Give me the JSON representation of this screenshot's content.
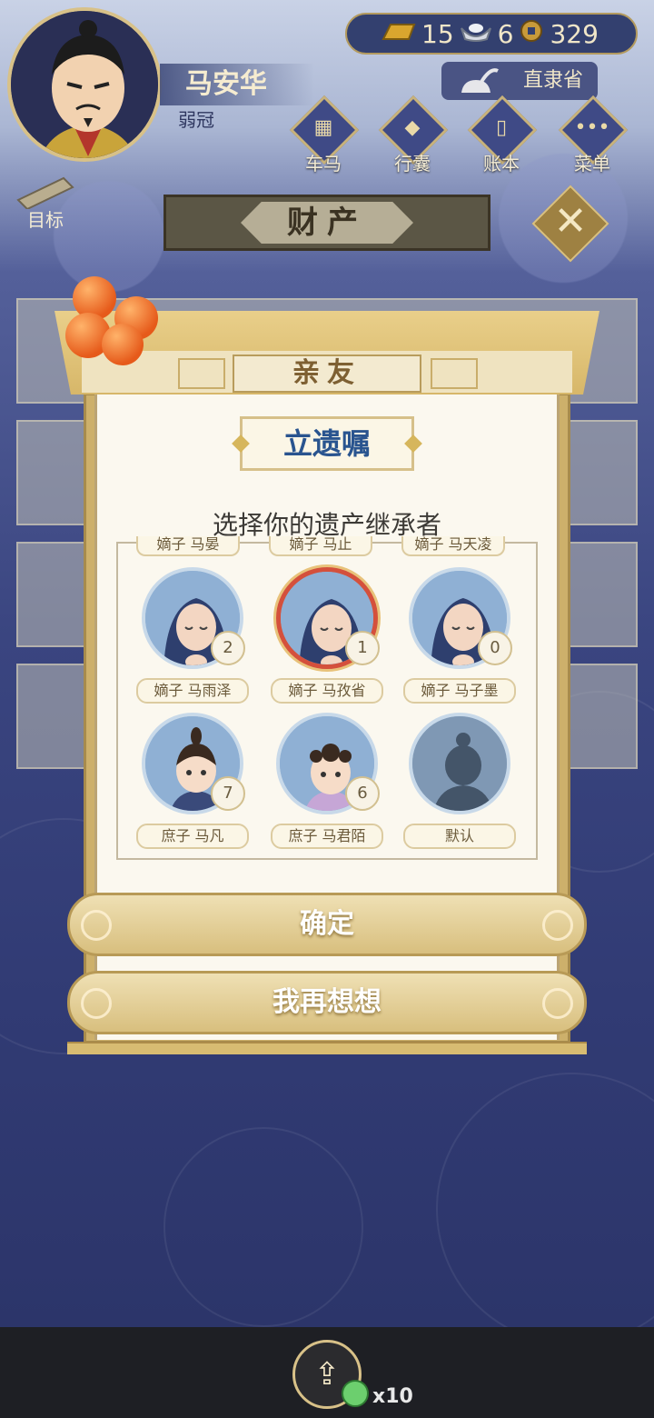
{
  "player": {
    "name": "马安华",
    "title": "弱冠"
  },
  "currency": {
    "gold": "15",
    "silver": "6",
    "coins": "329"
  },
  "region": {
    "label": "直隶省"
  },
  "menu": [
    {
      "label": "车马",
      "icon": "carriage-icon"
    },
    {
      "label": "行囊",
      "icon": "bag-icon"
    },
    {
      "label": "账本",
      "icon": "ledger-icon"
    },
    {
      "label": "菜单",
      "icon": "more-icon"
    }
  ],
  "goal": {
    "label": "目标"
  },
  "section": {
    "title": "财产"
  },
  "dialog": {
    "tab": "亲友",
    "title": "立遗嘱",
    "subtitle": "选择你的遗产继承者",
    "cut_labels": [
      "嫡子 马晏",
      "嫡子 马止",
      "嫡子 马天凌"
    ],
    "heirs": [
      {
        "label": "嫡子 马雨泽",
        "count": "2",
        "selected": false,
        "type": "monk"
      },
      {
        "label": "嫡子 马孜省",
        "count": "1",
        "selected": true,
        "type": "monk"
      },
      {
        "label": "嫡子 马子墨",
        "count": "0",
        "selected": false,
        "type": "monk"
      },
      {
        "label": "庶子 马凡",
        "count": "7",
        "selected": false,
        "type": "boy"
      },
      {
        "label": "庶子 马君陌",
        "count": "6",
        "selected": false,
        "type": "child"
      },
      {
        "label": "默认",
        "count": "",
        "selected": false,
        "type": "silhouette"
      }
    ],
    "confirm_label": "确定",
    "cancel_label": "我再想想"
  },
  "share": {
    "count": "x10"
  },
  "colors": {
    "title_blue": "#29548f",
    "gold": "#d8bf7e",
    "bg_navy": "#2e3a6f"
  }
}
